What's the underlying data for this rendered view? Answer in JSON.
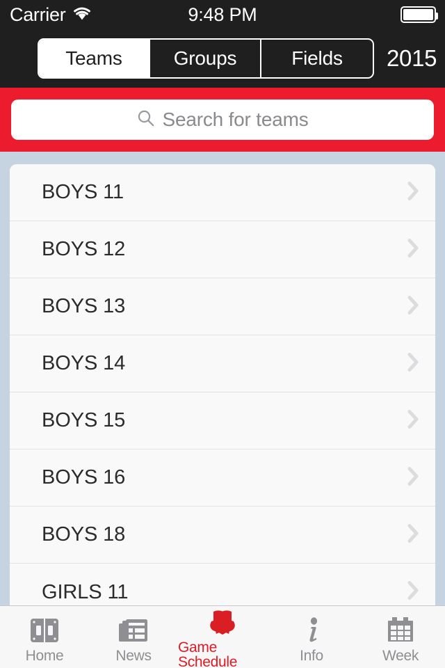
{
  "status_bar": {
    "carrier": "Carrier",
    "wifi_icon": "wifi-icon",
    "time": "9:48 PM",
    "battery_icon": "battery-full-icon"
  },
  "nav_bar": {
    "segments": [
      {
        "label": "Teams",
        "selected": true
      },
      {
        "label": "Groups",
        "selected": false
      },
      {
        "label": "Fields",
        "selected": false
      }
    ],
    "year": "2015"
  },
  "search": {
    "icon": "search-icon",
    "placeholder": "Search for teams",
    "value": "",
    "band_color": "#ED1B2E"
  },
  "list": {
    "background_color": "#C6D3E1",
    "rows": [
      {
        "label": "BOYS 11",
        "chevron": "chevron-right-icon"
      },
      {
        "label": "BOYS 12",
        "chevron": "chevron-right-icon"
      },
      {
        "label": "BOYS 13",
        "chevron": "chevron-right-icon"
      },
      {
        "label": "BOYS 14",
        "chevron": "chevron-right-icon"
      },
      {
        "label": "BOYS 15",
        "chevron": "chevron-right-icon"
      },
      {
        "label": "BOYS 16",
        "chevron": "chevron-right-icon"
      },
      {
        "label": "BOYS 18",
        "chevron": "chevron-right-icon"
      },
      {
        "label": "GIRLS 11",
        "chevron": "chevron-right-icon"
      }
    ]
  },
  "tab_bar": {
    "active_color": "#E01B24",
    "inactive_color": "#8E8E93",
    "items": [
      {
        "label": "Home",
        "icon": "doors-panel-icon",
        "active": false
      },
      {
        "label": "News",
        "icon": "newspaper-icon",
        "active": false
      },
      {
        "label": "Game Schedule",
        "icon": "shield-crest-icon",
        "active": true
      },
      {
        "label": "Info",
        "icon": "info-italic-i-icon",
        "active": false
      },
      {
        "label": "Week",
        "icon": "calendar-icon",
        "active": false
      }
    ]
  }
}
